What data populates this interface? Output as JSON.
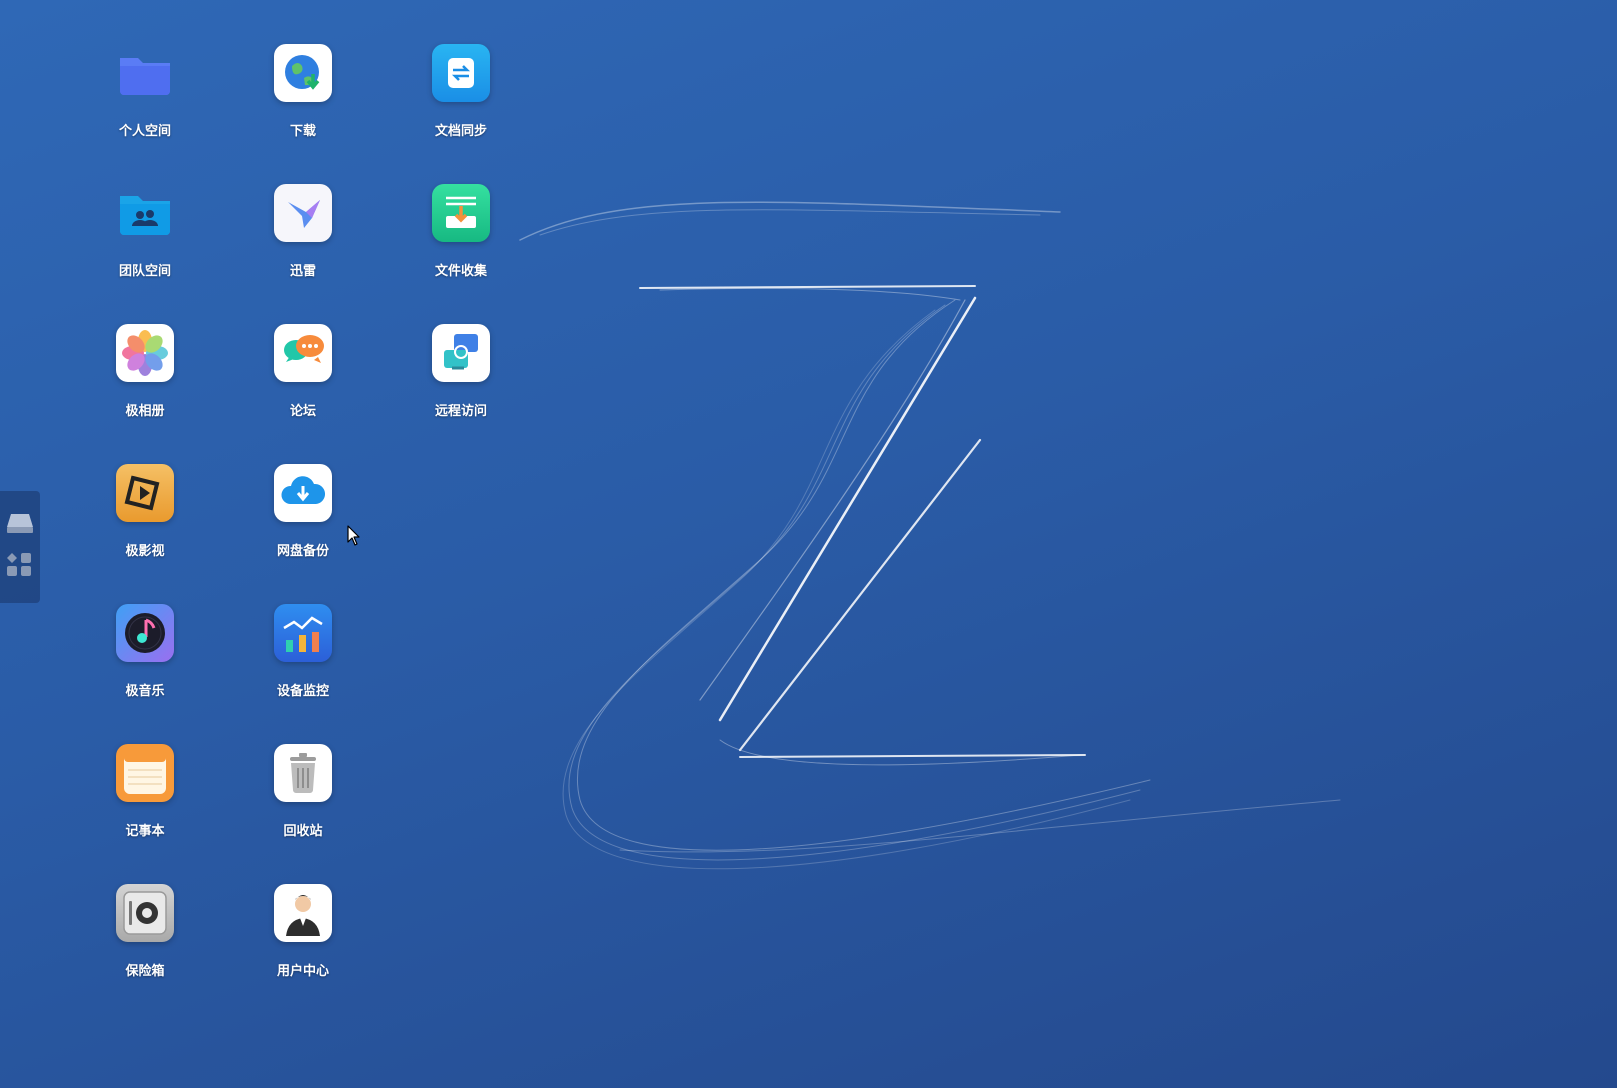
{
  "desktop": {
    "apps": [
      {
        "label": "个人空间",
        "icon": "folder-icon"
      },
      {
        "label": "下载",
        "icon": "download-globe-icon"
      },
      {
        "label": "文档同步",
        "icon": "sync-icon"
      },
      {
        "label": "团队空间",
        "icon": "team-folder-icon"
      },
      {
        "label": "迅雷",
        "icon": "thunder-bird-icon"
      },
      {
        "label": "文件收集",
        "icon": "file-collect-icon"
      },
      {
        "label": "极相册",
        "icon": "photos-flower-icon"
      },
      {
        "label": "论坛",
        "icon": "forum-chat-icon"
      },
      {
        "label": "远程访问",
        "icon": "remote-access-icon"
      },
      {
        "label": "极影视",
        "icon": "video-icon"
      },
      {
        "label": "网盘备份",
        "icon": "cloud-backup-icon"
      },
      {
        "label": "极音乐",
        "icon": "music-icon"
      },
      {
        "label": "设备监控",
        "icon": "monitor-chart-icon"
      },
      {
        "label": "记事本",
        "icon": "notepad-icon"
      },
      {
        "label": "回收站",
        "icon": "trash-icon"
      },
      {
        "label": "保险箱",
        "icon": "safe-icon"
      },
      {
        "label": "用户中心",
        "icon": "user-center-icon"
      }
    ]
  },
  "dock": {
    "items": [
      {
        "icon": "storage-drive-icon"
      },
      {
        "icon": "app-grid-icon"
      }
    ]
  },
  "colors": {
    "background_top": "#2f68b6",
    "background_bottom": "#24498d",
    "label_text": "#ffffff"
  }
}
